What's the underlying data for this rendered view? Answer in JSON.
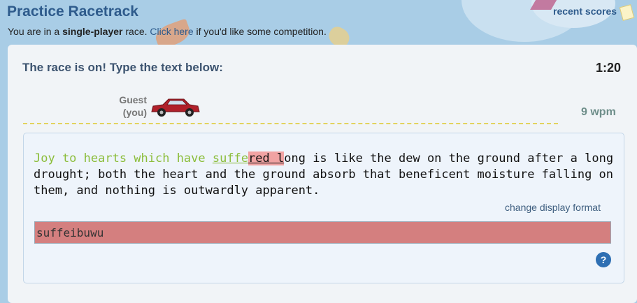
{
  "header": {
    "title": "Practice Racetrack",
    "recent_scores": "recent scores",
    "subtitle_prefix": "You are in a ",
    "subtitle_bold": "single-player",
    "subtitle_mid": " race. ",
    "subtitle_link": "Click here",
    "subtitle_suffix": " if you'd like some competition."
  },
  "race": {
    "status": "The race is on! Type the text below:",
    "timer": "1:20",
    "player_name": "Guest",
    "player_note": "(you)",
    "wpm": "9 wpm"
  },
  "passage": {
    "typed": "Joy to hearts which have ",
    "current_ok": "suffe",
    "current_err": "red l",
    "cursor": "l",
    "remaining": "ong is like the dew on the ground after a long drought; both the heart and the ground absorb that beneficent moisture falling on them, and nothing is outwardly apparent."
  },
  "controls": {
    "display_format": "change display format",
    "input_value": "suffeibuwu"
  },
  "icons": {
    "help": "help-icon",
    "car": "car-icon",
    "recent_scores": "notepad-icon"
  }
}
